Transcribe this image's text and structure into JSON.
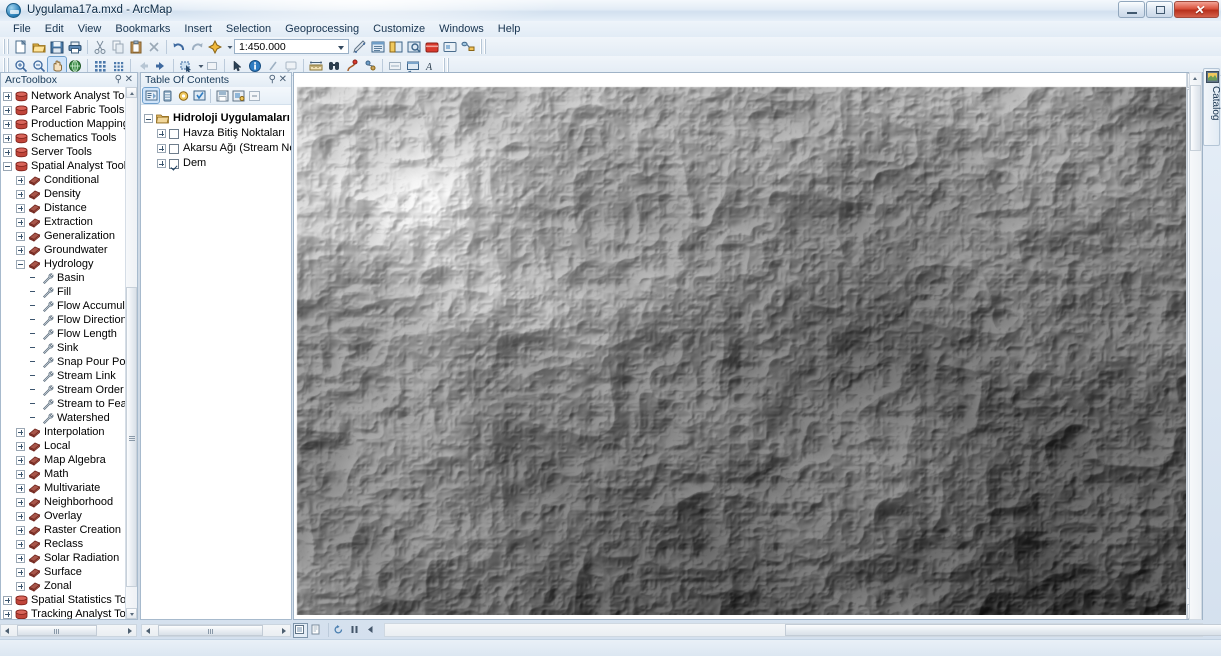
{
  "window": {
    "title": "Uygulama17a.mxd - ArcMap",
    "app_icon": "arcmap-globe-icon",
    "minimize_label": "—",
    "maximize_label": "",
    "close_label": "✕"
  },
  "menu": {
    "items": [
      {
        "label": "File",
        "name": "menu-file"
      },
      {
        "label": "Edit",
        "name": "menu-edit"
      },
      {
        "label": "View",
        "name": "menu-view"
      },
      {
        "label": "Bookmarks",
        "name": "menu-bookmarks"
      },
      {
        "label": "Insert",
        "name": "menu-insert"
      },
      {
        "label": "Selection",
        "name": "menu-selection"
      },
      {
        "label": "Geoprocessing",
        "name": "menu-geoprocessing"
      },
      {
        "label": "Customize",
        "name": "menu-customize"
      },
      {
        "label": "Windows",
        "name": "menu-windows"
      },
      {
        "label": "Help",
        "name": "menu-help"
      }
    ]
  },
  "standard_toolbar": {
    "scale": "1:450.000",
    "scale_placeholder": "1:450.000",
    "icons": [
      "new-document-icon",
      "open-folder-icon",
      "save-icon",
      "print-icon",
      "cut-icon",
      "copy-icon",
      "paste-icon",
      "delete-icon",
      "undo-icon",
      "redo-icon",
      "add-data-icon",
      "scale-dropdown-icon",
      "editor-toolbar-icon",
      "table-of-contents-icon",
      "catalog-window-icon",
      "search-window-icon",
      "arctoolbox-icon",
      "python-window-icon",
      "model-builder-icon"
    ]
  },
  "tools_toolbar": {
    "icons": [
      "zoom-in-icon",
      "zoom-out-icon",
      "pan-icon",
      "full-extent-icon",
      "fixed-zoom-in-icon",
      "fixed-zoom-out-icon",
      "go-back-extent-icon",
      "go-next-extent-icon",
      "select-features-icon",
      "clear-selection-icon",
      "select-elements-icon",
      "identify-icon",
      "hyperlink-icon",
      "html-popup-icon",
      "measure-icon",
      "find-icon",
      "find-route-icon",
      "xy-locate-icon",
      "time-slider-icon",
      "create-viewer-window-icon",
      "scale-text-icon"
    ]
  },
  "arctoolbox": {
    "title": "ArcToolbox",
    "pin_icon": "pin-icon",
    "close_icon": "close-icon",
    "tree": [
      {
        "label": "Network Analyst Tools",
        "depth": 0,
        "state": "plus",
        "icon": "toolbox-icon"
      },
      {
        "label": "Parcel Fabric Tools",
        "depth": 0,
        "state": "plus",
        "icon": "toolbox-icon"
      },
      {
        "label": "Production Mapping T",
        "depth": 0,
        "state": "plus",
        "icon": "toolbox-icon"
      },
      {
        "label": "Schematics Tools",
        "depth": 0,
        "state": "plus",
        "icon": "toolbox-icon"
      },
      {
        "label": "Server Tools",
        "depth": 0,
        "state": "plus",
        "icon": "toolbox-icon"
      },
      {
        "label": "Spatial Analyst Tools",
        "depth": 0,
        "state": "minus",
        "icon": "toolbox-icon"
      },
      {
        "label": "Conditional",
        "depth": 1,
        "state": "plus",
        "icon": "toolset-icon"
      },
      {
        "label": "Density",
        "depth": 1,
        "state": "plus",
        "icon": "toolset-icon"
      },
      {
        "label": "Distance",
        "depth": 1,
        "state": "plus",
        "icon": "toolset-icon"
      },
      {
        "label": "Extraction",
        "depth": 1,
        "state": "plus",
        "icon": "toolset-icon"
      },
      {
        "label": "Generalization",
        "depth": 1,
        "state": "plus",
        "icon": "toolset-icon"
      },
      {
        "label": "Groundwater",
        "depth": 1,
        "state": "plus",
        "icon": "toolset-icon"
      },
      {
        "label": "Hydrology",
        "depth": 1,
        "state": "minus",
        "icon": "toolset-icon"
      },
      {
        "label": "Basin",
        "depth": 2,
        "state": "none",
        "icon": "tool-wrench-icon"
      },
      {
        "label": "Fill",
        "depth": 2,
        "state": "none",
        "icon": "tool-wrench-icon"
      },
      {
        "label": "Flow Accumulati",
        "depth": 2,
        "state": "none",
        "icon": "tool-wrench-icon"
      },
      {
        "label": "Flow Direction",
        "depth": 2,
        "state": "none",
        "icon": "tool-wrench-icon"
      },
      {
        "label": "Flow Length",
        "depth": 2,
        "state": "none",
        "icon": "tool-wrench-icon"
      },
      {
        "label": "Sink",
        "depth": 2,
        "state": "none",
        "icon": "tool-wrench-icon"
      },
      {
        "label": "Snap Pour Point",
        "depth": 2,
        "state": "none",
        "icon": "tool-wrench-icon"
      },
      {
        "label": "Stream Link",
        "depth": 2,
        "state": "none",
        "icon": "tool-wrench-icon"
      },
      {
        "label": "Stream Order",
        "depth": 2,
        "state": "none",
        "icon": "tool-wrench-icon"
      },
      {
        "label": "Stream to Featur",
        "depth": 2,
        "state": "none",
        "icon": "tool-wrench-icon"
      },
      {
        "label": "Watershed",
        "depth": 2,
        "state": "none",
        "icon": "tool-wrench-icon"
      },
      {
        "label": "Interpolation",
        "depth": 1,
        "state": "plus",
        "icon": "toolset-icon"
      },
      {
        "label": "Local",
        "depth": 1,
        "state": "plus",
        "icon": "toolset-icon"
      },
      {
        "label": "Map Algebra",
        "depth": 1,
        "state": "plus",
        "icon": "toolset-icon"
      },
      {
        "label": "Math",
        "depth": 1,
        "state": "plus",
        "icon": "toolset-icon"
      },
      {
        "label": "Multivariate",
        "depth": 1,
        "state": "plus",
        "icon": "toolset-icon"
      },
      {
        "label": "Neighborhood",
        "depth": 1,
        "state": "plus",
        "icon": "toolset-icon"
      },
      {
        "label": "Overlay",
        "depth": 1,
        "state": "plus",
        "icon": "toolset-icon"
      },
      {
        "label": "Raster Creation",
        "depth": 1,
        "state": "plus",
        "icon": "toolset-icon"
      },
      {
        "label": "Reclass",
        "depth": 1,
        "state": "plus",
        "icon": "toolset-icon"
      },
      {
        "label": "Solar Radiation",
        "depth": 1,
        "state": "plus",
        "icon": "toolset-icon"
      },
      {
        "label": "Surface",
        "depth": 1,
        "state": "plus",
        "icon": "toolset-icon"
      },
      {
        "label": "Zonal",
        "depth": 1,
        "state": "plus",
        "icon": "toolset-icon"
      },
      {
        "label": "Spatial Statistics Tools",
        "depth": 0,
        "state": "plus",
        "icon": "toolbox-icon"
      },
      {
        "label": "Tracking Analyst Tools",
        "depth": 0,
        "state": "plus",
        "icon": "toolbox-icon"
      }
    ]
  },
  "toc": {
    "title": "Table Of Contents",
    "pin_icon": "pin-icon",
    "close_icon": "close-icon",
    "toolbar_icons": [
      "list-by-drawing-order-icon",
      "list-by-source-icon",
      "list-by-visibility-icon",
      "list-by-selection-icon",
      "options-icon",
      "add-basemap-icon",
      "toc-extra-icon"
    ],
    "layers": [
      {
        "label": "Hidroloji Uygulamaları",
        "depth": 0,
        "type": "dataframe",
        "checked": null,
        "expanded": true,
        "bold": true
      },
      {
        "label": "Havza Bitiş Noktaları",
        "depth": 1,
        "type": "layer",
        "checked": false,
        "expanded": false,
        "bold": false
      },
      {
        "label": "Akarsu Ağı (Stream Netwo",
        "depth": 1,
        "type": "layer",
        "checked": false,
        "expanded": false,
        "bold": false
      },
      {
        "label": "Dem",
        "depth": 1,
        "type": "layer",
        "checked": true,
        "expanded": false,
        "bold": false
      }
    ]
  },
  "map": {
    "layer_rendered": "Dem",
    "renderer": "grayscale-hillshade-dem",
    "view_buttons": [
      {
        "name": "data-view-button",
        "icon": "data-view-icon",
        "selected": true
      },
      {
        "name": "layout-view-button",
        "icon": "layout-view-icon",
        "selected": false
      },
      {
        "name": "refresh-view-button",
        "icon": "refresh-icon",
        "selected": false
      },
      {
        "name": "pause-drawing-button",
        "icon": "pause-icon",
        "selected": false
      },
      {
        "name": "previous-extent-button",
        "icon": "back-arrow-icon",
        "selected": false
      }
    ]
  },
  "catalog": {
    "label": "Catalog",
    "icon": "catalog-icon"
  }
}
